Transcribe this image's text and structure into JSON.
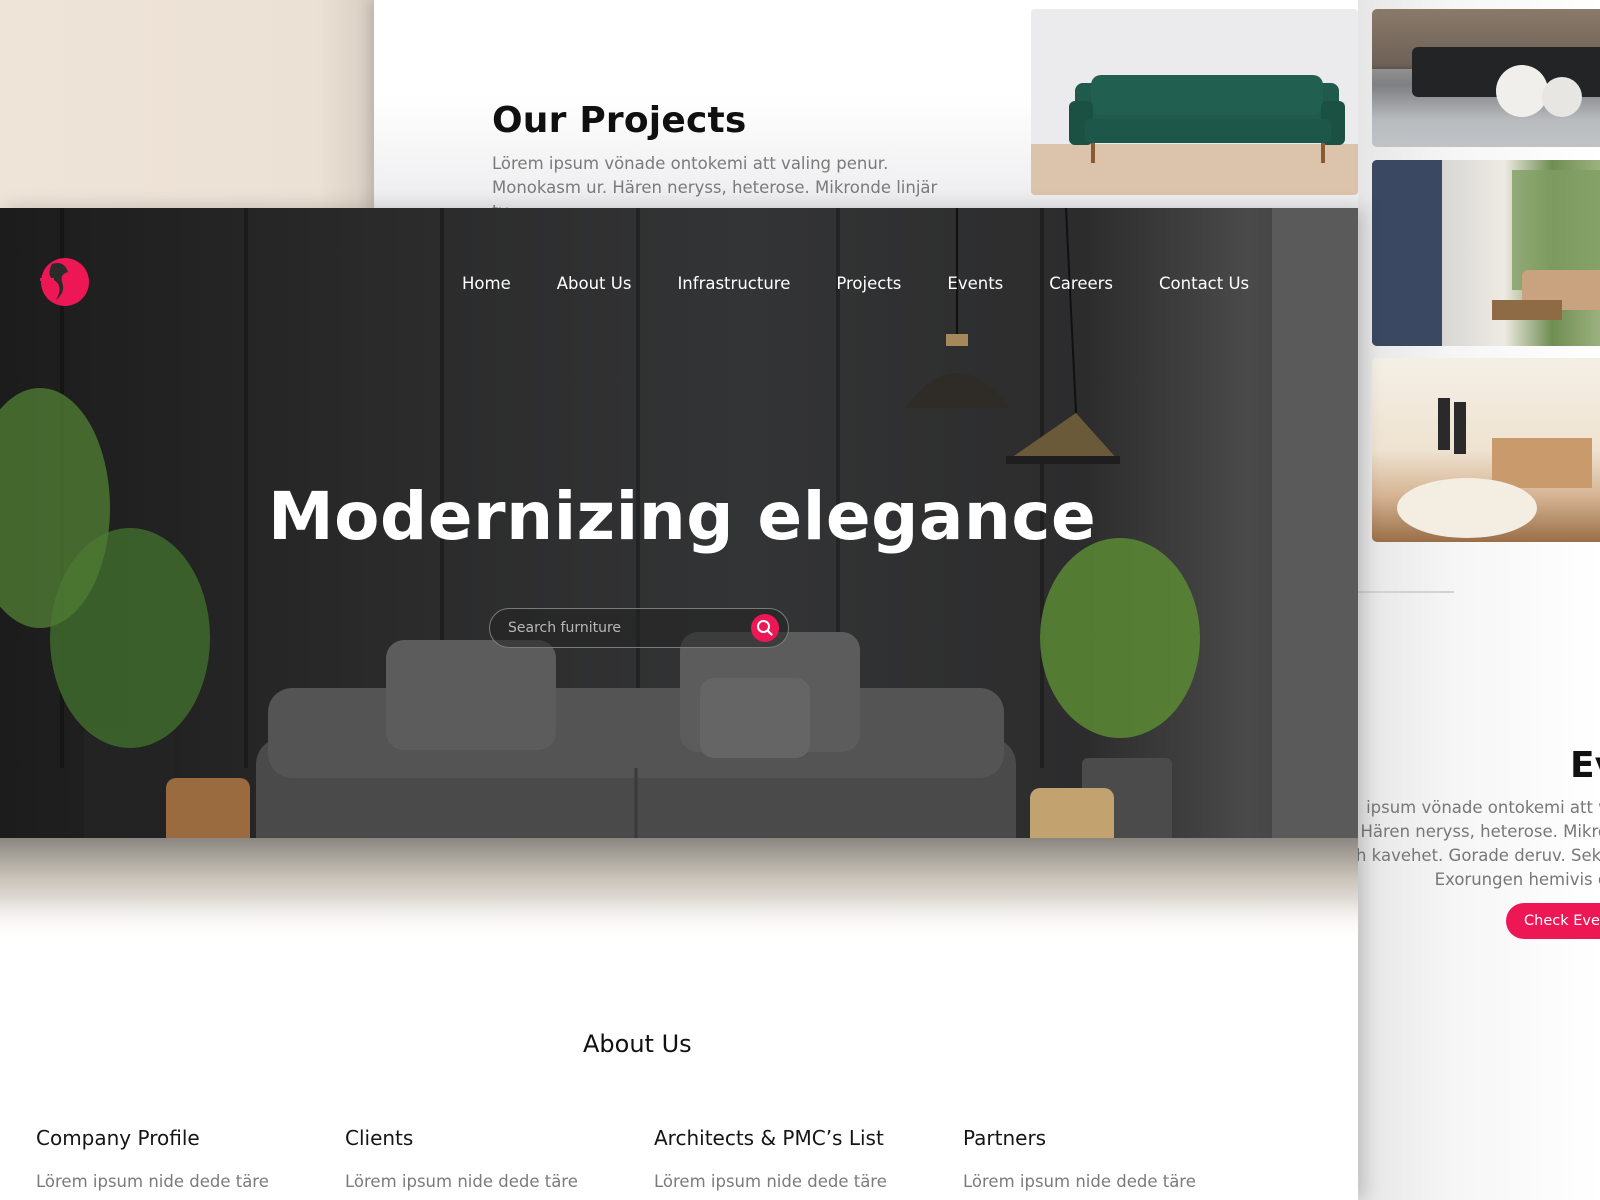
{
  "projects": {
    "title": "Our Projects",
    "text": "Lörem ipsum vönade ontokemi att valing penur. Monokasm ur. Hären neryss, heterose. Mikronde linjär tv"
  },
  "events": {
    "title": "Ev",
    "lines": [
      "ipsum vönade ontokemi att v",
      "r. Hären neryss, heterose. Mikro",
      "h kavehet. Gorade deruv. Sekr",
      "Exorungen hemivis o"
    ],
    "button_label": "Check Event"
  },
  "nav": {
    "items": [
      "Home",
      "About Us",
      "Infrastructure",
      "Projects",
      "Events",
      "Careers",
      "Contact Us"
    ]
  },
  "hero": {
    "title": "Modernizing elegance",
    "search_placeholder": "Search furniture"
  },
  "about": {
    "title": "About Us",
    "columns": [
      {
        "title": "Company Profile",
        "text": "Lörem ipsum nide dede täre"
      },
      {
        "title": "Clients",
        "text": "Lörem ipsum nide dede täre"
      },
      {
        "title": "Architects & PMC’s List",
        "text": "Lörem ipsum nide dede täre"
      },
      {
        "title": "Partners",
        "text": "Lörem ipsum nide dede täre"
      }
    ]
  },
  "icons": {
    "logo": "brand-logo-icon",
    "search": "search-icon"
  },
  "colors": {
    "accent": "#ee1755",
    "hero_dark": "#2b2b2c",
    "text_muted": "#7b7b7b"
  }
}
